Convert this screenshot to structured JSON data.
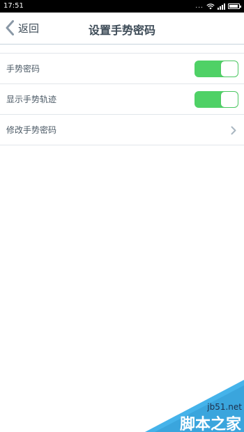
{
  "status_bar": {
    "time": "17:51",
    "dots": "...",
    "icons": [
      "wifi-icon",
      "signal-icon",
      "battery-icon"
    ]
  },
  "nav": {
    "back_label": "返回",
    "title": "设置手势密码"
  },
  "settings": {
    "items": [
      {
        "label": "手势密码",
        "control": "toggle",
        "on": true
      },
      {
        "label": "显示手势轨迹",
        "control": "toggle",
        "on": true
      },
      {
        "label": "修改手势密码",
        "control": "chevron"
      }
    ]
  },
  "watermark": {
    "site": "jb51.net",
    "brand": "脚本之家"
  },
  "colors": {
    "toggle_on": "#4fd166",
    "text": "#3d4b57",
    "watermark_blue": "#45b3ea"
  }
}
